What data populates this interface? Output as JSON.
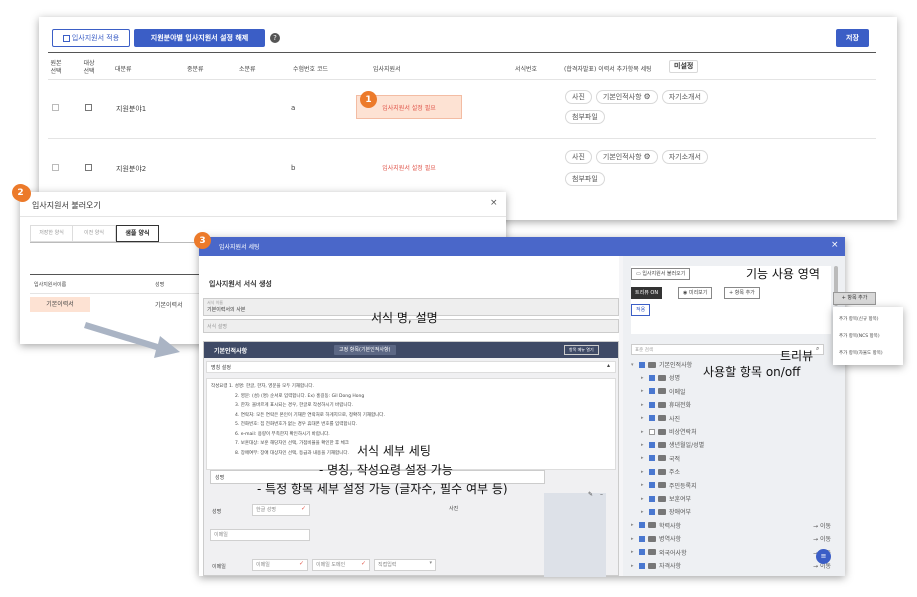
{
  "panel1": {
    "apply_button": "입사지원서 적용",
    "clear_button": "지원분야별 입사지원서 설정 해제",
    "save_button": "저장",
    "headers": {
      "original_select": [
        "원본",
        "선택"
      ],
      "target_select": [
        "대상",
        "선택"
      ],
      "major": "대분류",
      "middle": "중분류",
      "minor": "소분류",
      "recruit_code": "수험번호 코드",
      "application": "입사지원서",
      "format_no": "서식번호",
      "extra_items": "(합격자발표) 이력서 추가항목 세팅",
      "unset_button": "미설정"
    },
    "rows": [
      {
        "field": "지원분야1",
        "code": "a",
        "status": "입사지원서 설정 필요",
        "pills": [
          "사진",
          "기본인적사항",
          "자기소개서"
        ],
        "pills2": [
          "첨부파일"
        ]
      },
      {
        "field": "지원분야2",
        "code": "b",
        "status": "입사지원서 설정 필요",
        "pills": [
          "사진",
          "기본인적사항",
          "자기소개서"
        ],
        "pills2": [
          "첨부파일"
        ]
      }
    ],
    "badge": "1"
  },
  "panel2": {
    "badge": "2",
    "title": "입사지원서 불러오기",
    "close": "×",
    "tabs": [
      "저장한 양식",
      "이전 양식",
      "샘플 양식"
    ],
    "col_name": "입사지원서이름",
    "col_format": "성명",
    "row_name": "기본이력서",
    "row_format": "기본이력서"
  },
  "panel3": {
    "badge": "3",
    "title": "입사지원서 세팅",
    "close": "×",
    "section_title": "입사지원서 서식 생성",
    "name_label": "서식 이름",
    "name_value": "기본이력서의 사본",
    "desc_placeholder": "서식 설명",
    "block_title": "기본인적사항",
    "fixed_item": "고정 항목(기본인적사항)",
    "item_menu": "항목 메뉴 열기",
    "guide_label": "명칭 설정",
    "guide_lines": [
      "작성요령 1. 성명: 한글, 한자, 영문을 모두 기재합니다.",
      "2. 영문: (성) (명) 순서로 입력합니다. Ex) 홍길동: Gil Dong Hong",
      "3. 한자: 올바르게 표시되는 경우, 한글로 작성하시기 바랍니다.",
      "4. 연락처: 모든 연락은 본인이 기재한 연락처로 하게지므로, 정확히 기재합니다.",
      "5. 전화번호: 집 전화번호가 없는 경우 휴대폰 번호를 입력합니다.",
      "6. e-mail: 용량이 부족한지 확인하시기 바랍니다.",
      "7. 보훈대상: 보훈 해당자인 선택, 가점비율을 확인한 후 체크",
      "8. 장애여부: 장애 대상자인 선택, 등급과 내용을 기재합니다."
    ],
    "field_name_label": "성명",
    "field_name_sub": "성명",
    "field_name_hint": "한글 성명",
    "field_email_label": "이메일",
    "field_email_sub": "이메일",
    "field_email_hint": "이메일",
    "field_email_domain": "이메일 도메인",
    "field_email_select": "직접입력",
    "photo_label": "사진",
    "toolbar": {
      "load": "입사지원서 불러오기",
      "tree_on": "트리뷰 ON",
      "preview": "미리보기",
      "add_item": "+ 항목 추가",
      "confirm": "적용"
    },
    "search_placeholder": "표준 검색",
    "tree": [
      {
        "label": "기본인적사항",
        "level": 0,
        "checked": true
      },
      {
        "label": "성명",
        "level": 1,
        "checked": true
      },
      {
        "label": "이메일",
        "level": 1,
        "checked": true
      },
      {
        "label": "휴대전화",
        "level": 1,
        "checked": true
      },
      {
        "label": "사진",
        "level": 1,
        "checked": true
      },
      {
        "label": "비상연락처",
        "level": 1,
        "checked": false
      },
      {
        "label": "생년월일/성별",
        "level": 1,
        "checked": true
      },
      {
        "label": "국적",
        "level": 1,
        "checked": true
      },
      {
        "label": "주소",
        "level": 1,
        "checked": true
      },
      {
        "label": "주민등록지",
        "level": 1,
        "checked": true
      },
      {
        "label": "보훈여부",
        "level": 1,
        "checked": true
      },
      {
        "label": "장애여부",
        "level": 1,
        "checked": true
      },
      {
        "label": "학력사항",
        "level": 0,
        "checked": true
      },
      {
        "label": "병역사항",
        "level": 0,
        "checked": true
      },
      {
        "label": "외국어사항",
        "level": 0,
        "checked": true
      },
      {
        "label": "자격사항",
        "level": 0,
        "checked": true
      }
    ],
    "move_label": "이동",
    "dropdown": {
      "button": "+ 항목 추가",
      "items": [
        "추가 항목(신규 항목)",
        "추가 항목(NCS 항목)",
        "추가 항목(자율도 항목)"
      ]
    }
  },
  "annotations": {
    "feature_area": "기능 사용 영역",
    "name_desc": "서식 명, 설명",
    "tree_view": "트리뷰",
    "tree_view_sub": "사용할 항목 on/off",
    "detail_title": "서식 세부 세팅",
    "detail_line1": "-   명칭, 작성요령 설정 가능",
    "detail_line2": "-   특정 항목 세부 설정 가능 (글자수, 필수 여부 등)"
  }
}
